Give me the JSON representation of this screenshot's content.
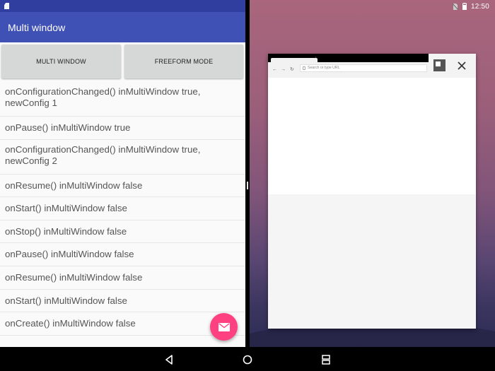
{
  "app": {
    "title": "Multi window"
  },
  "buttons": {
    "multi_window": "MULTI WINDOW",
    "freeform_mode": "FREEFORM MODE"
  },
  "log": [
    "onConfigurationChanged() inMultiWindow true, newConfig 1",
    "onPause() inMultiWindow true",
    "onConfigurationChanged() inMultiWindow true, newConfig 2",
    "onResume() inMultiWindow false",
    "onStart() inMultiWindow false",
    "onStop() inMultiWindow false",
    "onPause() inMultiWindow false",
    "onResume() inMultiWindow false",
    "onStart() inMultiWindow false",
    "onCreate() inMultiWindow false"
  ],
  "status": {
    "time": "12:50"
  },
  "browser": {
    "omnibox_placeholder": "Search or type URL",
    "tab_close": "×"
  },
  "fab": {
    "icon": "email-icon"
  },
  "colors": {
    "primary": "#3f51b5",
    "primary_dark": "#303f9f",
    "accent": "#ff4081"
  },
  "navbar": {
    "icons": [
      "back-icon",
      "home-icon",
      "overview-icon"
    ]
  }
}
